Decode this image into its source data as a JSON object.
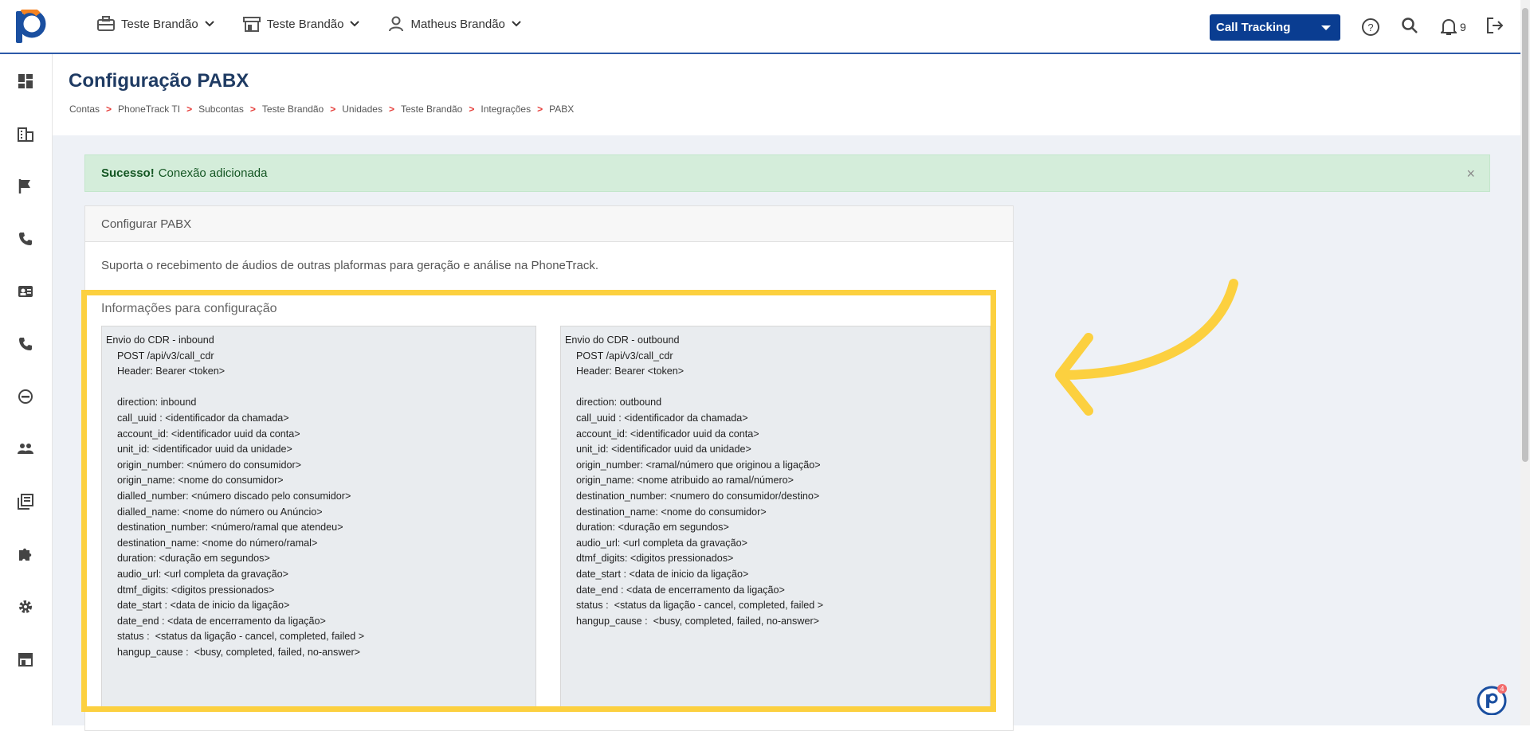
{
  "topbar": {
    "nav": [
      {
        "label": "Teste Brandão",
        "icon": "briefcase-icon"
      },
      {
        "label": "Teste Brandão",
        "icon": "store-icon"
      },
      {
        "label": "Matheus Brandão",
        "icon": "user-icon"
      }
    ],
    "product_select": "Call Tracking",
    "notifications_count": "9"
  },
  "sidebar": {
    "icons": [
      "dashboard-icon",
      "building-icon",
      "flag-icon",
      "phone-icon",
      "contact-card-icon",
      "phone-icon",
      "chat-icon",
      "people-icon",
      "library-icon",
      "puzzle-icon",
      "gear-icon",
      "store-icon"
    ]
  },
  "page": {
    "title": "Configuração PABX",
    "breadcrumb": [
      "Contas",
      "PhoneTrack TI",
      "Subcontas",
      "Teste Brandão",
      "Unidades",
      "Teste Brandão",
      "Integrações",
      "PABX"
    ],
    "breadcrumb_separator": ">"
  },
  "alert": {
    "strong": "Sucesso!",
    "message": "Conexão adicionada",
    "close": "×"
  },
  "card": {
    "header": "Configurar PABX",
    "description": "Suporta o recebimento de áudios de outras plaformas para geração e análise na PhoneTrack.",
    "info_title": "Informações para configuração",
    "inbound": "Envio do CDR - inbound\n    POST /api/v3/call_cdr\n    Header: Bearer <token>\n\n    direction: inbound\n    call_uuid : <identificador da chamada>\n    account_id: <identificador uuid da conta>\n    unit_id: <identificador uuid da unidade>\n    origin_number: <número do consumidor>\n    origin_name: <nome do consumidor>\n    dialled_number: <número discado pelo consumidor>\n    dialled_name: <nome do número ou Anúncio>\n    destination_number: <número/ramal que atendeu>\n    destination_name: <nome do número/ramal>\n    duration: <duração em segundos>\n    audio_url: <url completa da gravação>\n    dtmf_digits: <digitos pressionados>\n    date_start : <data de inicio da ligação>\n    date_end : <data de encerramento da ligação>\n    status :  <status da ligação - cancel, completed, failed >\n    hangup_cause :  <busy, completed, failed, no-answer>",
    "outbound": "Envio do CDR - outbound\n    POST /api/v3/call_cdr\n    Header: Bearer <token>\n\n    direction: outbound\n    call_uuid : <identificador da chamada>\n    account_id: <identificador uuid da conta>\n    unit_id: <identificador uuid da unidade>\n    origin_number: <ramal/número que originou a ligação>\n    origin_name: <nome atribuido ao ramal/número>\n    destination_number: <numero do consumidor/destino>\n    destination_name: <nome do consumidor>\n    duration: <duração em segundos>\n    audio_url: <url completa da gravação>\n    dtmf_digits: <digitos pressionados>\n    date_start : <data de inicio da ligação>\n    date_end : <data de encerramento da ligação>\n    status :  <status da ligação - cancel, completed, failed >\n    hangup_cause :  <busy, completed, failed, no-answer>"
  },
  "help_badge": "4",
  "colors": {
    "accent": "#0a3d91",
    "highlight": "#fcd03f",
    "success_bg": "#d4edda",
    "breadcrumb_sep": "#e53935"
  }
}
